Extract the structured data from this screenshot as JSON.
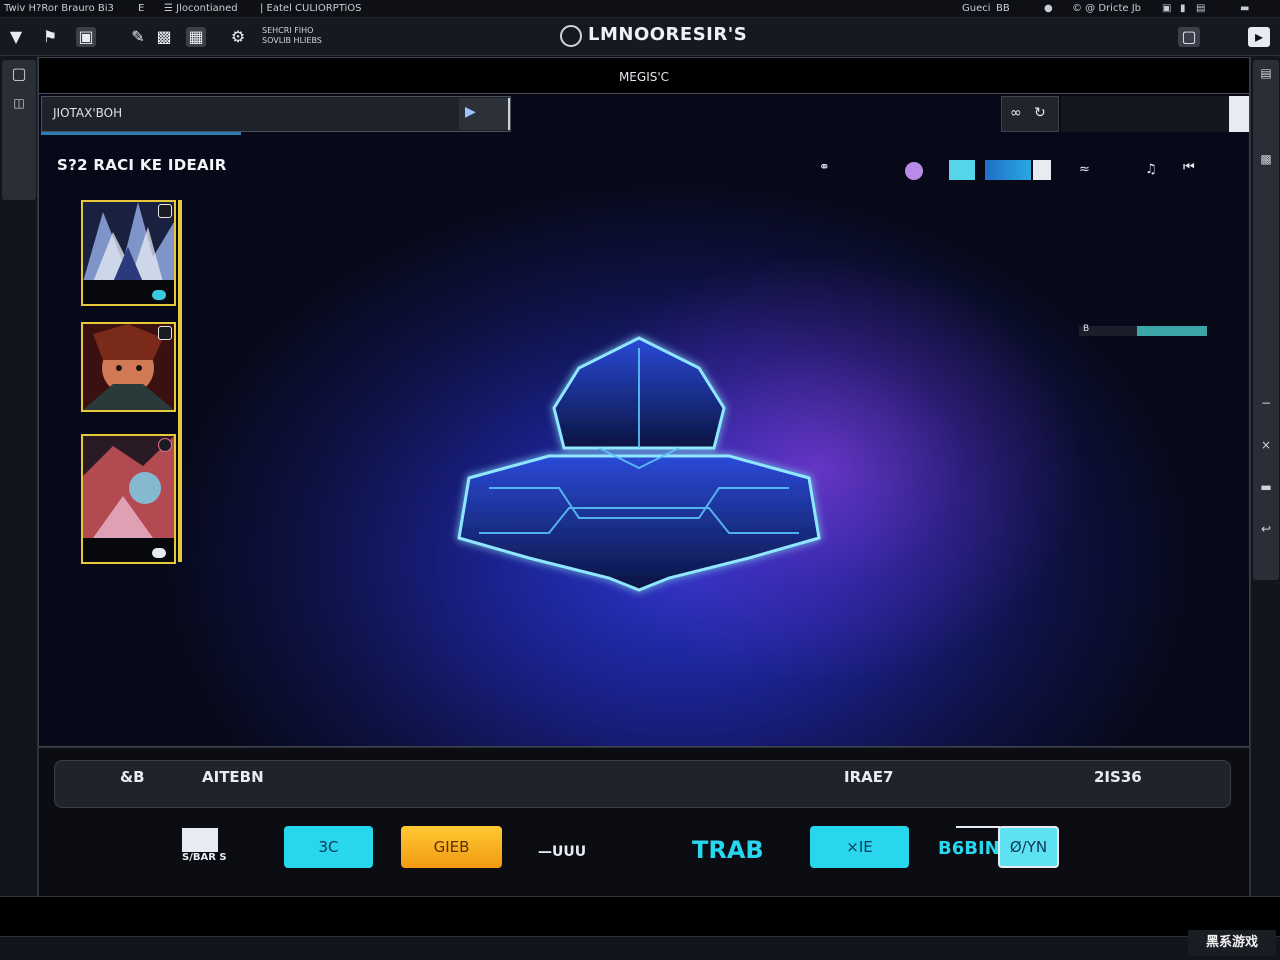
{
  "window": {
    "menu_items": [
      "Twiv H?Ror Brauro Bi3",
      "E",
      "☰ Jlocontianed",
      "| Eatel CULIORPTiOS"
    ],
    "menu_right": [
      "Gueci",
      "BB",
      "© @ Dricte Jb"
    ],
    "app_title": "LMNOORESIR'S"
  },
  "toolbar": {
    "caption": "SEHCRI FIHO\nSOVLIB HLIEBS"
  },
  "viewport": {
    "header": "MEGIS'C",
    "search_value": "JIOTAX'BOH",
    "section_title": "S?2 RACI KE IDEAIR"
  },
  "cards": [
    {
      "name": "card-1"
    },
    {
      "name": "card-2"
    },
    {
      "name": "card-3"
    }
  ],
  "meter": {
    "label": "B",
    "level": 0.55
  },
  "info_bar": {
    "left_short": "&B",
    "left_title": "AITEBN",
    "right_a": "IRAE7",
    "right_b": "2IS36"
  },
  "actions": {
    "left_label": "S/BAR S",
    "btn_1": "3C",
    "btn_2": "GIEB",
    "mid_text": "—UUU",
    "cyan_text": "TRAB",
    "btn_3": "×IE",
    "right_text": "B6BIN",
    "btn_4": "Ø/YN"
  },
  "footer": {
    "tag": "黑系游戏"
  },
  "colors": {
    "accent_cyan": "#28d7ee",
    "accent_orange": "#f7a91c",
    "card_border": "#e7c83a",
    "glow_purple": "#a046f0"
  }
}
